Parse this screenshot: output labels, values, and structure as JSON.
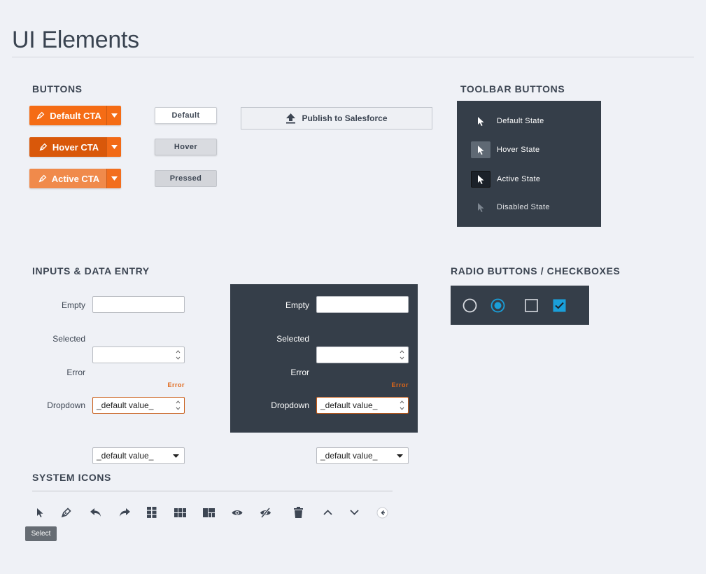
{
  "page": {
    "title": "UI Elements"
  },
  "buttons": {
    "section_title": "BUTTONS",
    "cta": [
      {
        "label": "Default CTA",
        "state": "default"
      },
      {
        "label": "Hover CTA",
        "state": "hover"
      },
      {
        "label": "Active CTA",
        "state": "active"
      }
    ],
    "plain": [
      {
        "label": "Default"
      },
      {
        "label": "Hover"
      },
      {
        "label": "Pressed"
      }
    ],
    "publish_label": "Publish to Salesforce"
  },
  "toolbar": {
    "section_title": "TOOLBAR BUTTONS",
    "items": [
      {
        "label": "Default State",
        "icon": "cursor-icon"
      },
      {
        "label": "Hover State",
        "icon": "cursor-icon"
      },
      {
        "label": "Active State",
        "icon": "cursor-icon"
      },
      {
        "label": "Disabled State",
        "icon": "cursor-icon"
      }
    ]
  },
  "inputs": {
    "section_title": "INPUTS & DATA ENTRY",
    "light": {
      "empty_label": "Empty",
      "selected_label": "Selected",
      "error_label": "Error",
      "error_value": "_default value_",
      "error_message": "Error",
      "dropdown_label": "Dropdown",
      "dropdown_value": "_default value_"
    },
    "dark": {
      "empty_label": "Empty",
      "selected_label": "Selected",
      "error_label": "Error",
      "error_value": "_default value_",
      "error_message": "Error",
      "dropdown_label": "Dropdown",
      "dropdown_value": "_default value_"
    }
  },
  "choices": {
    "section_title": "RADIO BUTTONS / CHECKBOXES",
    "radio_unchecked": false,
    "radio_checked": true,
    "checkbox_unchecked": false,
    "checkbox_checked": true,
    "accent": "#1a9fd9"
  },
  "system_icons": {
    "section_title": "SYSTEM ICONS",
    "icons": [
      "cursor-icon",
      "pen-icon",
      "undo-icon",
      "redo-icon",
      "grid-2x3-icon",
      "grid-3x2-icon",
      "layout-icon",
      "eye-icon",
      "eye-off-icon",
      "trash-icon",
      "chevron-up-icon",
      "chevron-down-icon",
      "back-circle-icon"
    ],
    "tooltip": "Select"
  },
  "colors": {
    "cta_orange": "#f56c15",
    "dark_panel": "#353e49",
    "error": "#e06718"
  }
}
